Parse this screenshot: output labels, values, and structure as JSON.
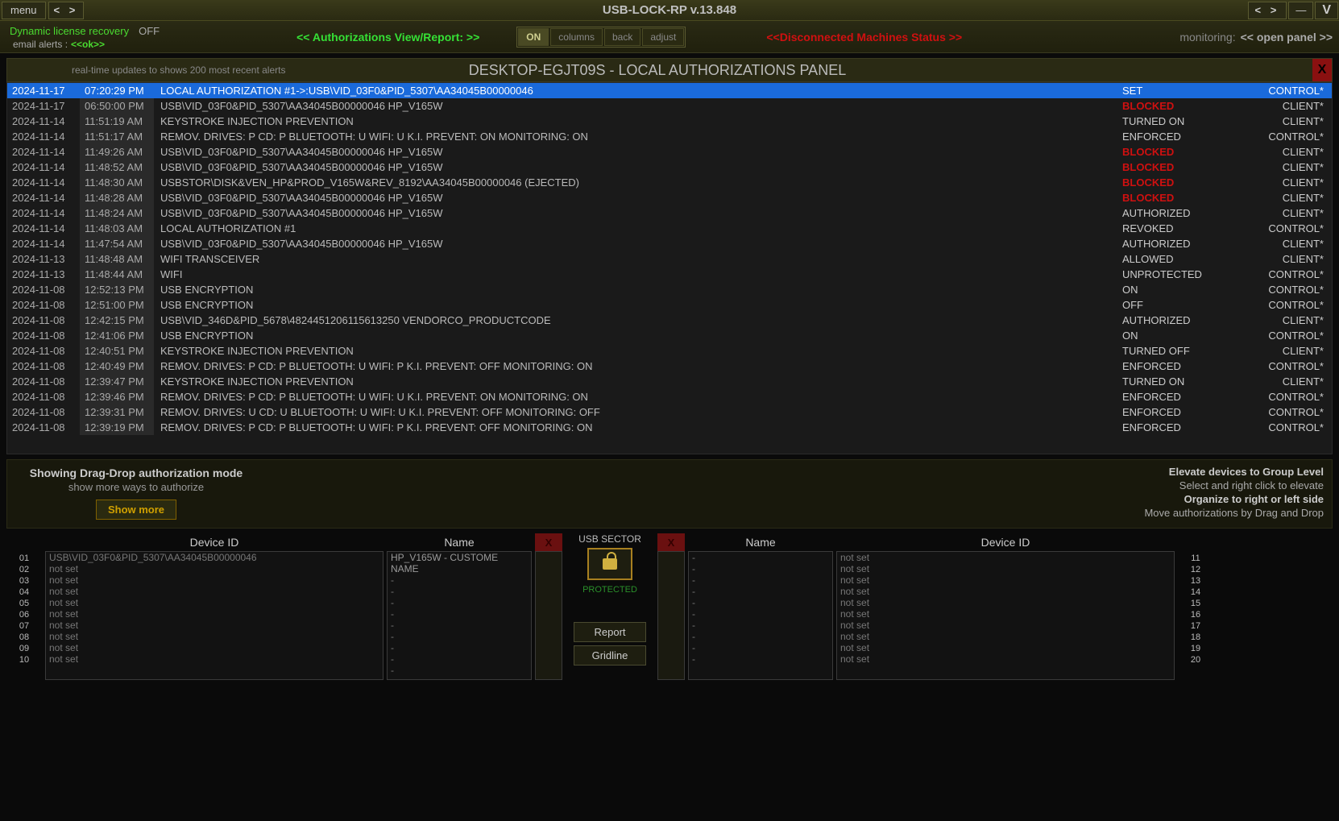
{
  "titlebar": {
    "menu": "menu",
    "arrows": "<  >",
    "title": "USB-LOCK-RP v.13.848",
    "minimize": "—",
    "version": "V"
  },
  "toolbar": {
    "lic_recovery": "Dynamic license recovery",
    "off": "OFF",
    "email_alerts": "email alerts :",
    "ok": "<<ok>>",
    "auth_view": "<< Authorizations View/Report: >>",
    "btn_on": "ON",
    "btn_columns": "columns",
    "btn_back": "back",
    "btn_adjust": "adjust",
    "disc_status": "<<Disconnected Machines Status >>",
    "monitoring": "monitoring:",
    "open_panel": "<<  open panel >>"
  },
  "panel": {
    "hint": "real-time updates to shows 200 most recent alerts",
    "title": "DESKTOP-EGJT09S - LOCAL AUTHORIZATIONS PANEL",
    "close": "X"
  },
  "events": [
    {
      "date": "2024-11-17",
      "time": "07:20:29 PM",
      "desc": "LOCAL AUTHORIZATION #1->:USB\\VID_03F0&PID_5307\\AA34045B00000046",
      "status": "SET",
      "src": "CONTROL*",
      "sel": true
    },
    {
      "date": "2024-11-17",
      "time": "06:50:00 PM",
      "desc": "USB\\VID_03F0&PID_5307\\AA34045B00000046 HP_V165W",
      "status": "BLOCKED",
      "src": "CLIENT*"
    },
    {
      "date": "2024-11-14",
      "time": "11:51:19 AM",
      "desc": "KEYSTROKE INJECTION PREVENTION",
      "status": "TURNED ON",
      "src": "CLIENT*"
    },
    {
      "date": "2024-11-14",
      "time": "11:51:17 AM",
      "desc": "REMOV. DRIVES: P     CD: P     BLUETOOTH: U     WIFI: U     K.I. PREVENT: ON  MONITORING: ON",
      "status": "ENFORCED",
      "src": "CONTROL*"
    },
    {
      "date": "2024-11-14",
      "time": "11:49:26 AM",
      "desc": "USB\\VID_03F0&PID_5307\\AA34045B00000046 HP_V165W",
      "status": "BLOCKED",
      "src": "CLIENT*"
    },
    {
      "date": "2024-11-14",
      "time": "11:48:52 AM",
      "desc": "USB\\VID_03F0&PID_5307\\AA34045B00000046 HP_V165W",
      "status": "BLOCKED",
      "src": "CLIENT*"
    },
    {
      "date": "2024-11-14",
      "time": "11:48:30 AM",
      "desc": "USBSTOR\\DISK&VEN_HP&PROD_V165W&REV_8192\\AA34045B00000046   (EJECTED)",
      "status": "BLOCKED",
      "src": "CLIENT*"
    },
    {
      "date": "2024-11-14",
      "time": "11:48:28 AM",
      "desc": "USB\\VID_03F0&PID_5307\\AA34045B00000046 HP_V165W",
      "status": "BLOCKED",
      "src": "CLIENT*"
    },
    {
      "date": "2024-11-14",
      "time": "11:48:24 AM",
      "desc": "USB\\VID_03F0&PID_5307\\AA34045B00000046 HP_V165W",
      "status": "AUTHORIZED",
      "src": "CLIENT*"
    },
    {
      "date": "2024-11-14",
      "time": "11:48:03 AM",
      "desc": "LOCAL AUTHORIZATION #1",
      "status": "REVOKED",
      "src": "CONTROL*"
    },
    {
      "date": "2024-11-14",
      "time": "11:47:54 AM",
      "desc": "USB\\VID_03F0&PID_5307\\AA34045B00000046 HP_V165W",
      "status": "AUTHORIZED",
      "src": "CLIENT*"
    },
    {
      "date": "2024-11-13",
      "time": "11:48:48 AM",
      "desc": "WIFI TRANSCEIVER",
      "status": "ALLOWED",
      "src": "CLIENT*"
    },
    {
      "date": "2024-11-13",
      "time": "11:48:44 AM",
      "desc": "WIFI",
      "status": "UNPROTECTED",
      "src": "CONTROL*"
    },
    {
      "date": "2024-11-08",
      "time": "12:52:13 PM",
      "desc": "USB ENCRYPTION",
      "status": "ON",
      "src": "CONTROL*"
    },
    {
      "date": "2024-11-08",
      "time": "12:51:00 PM",
      "desc": "USB ENCRYPTION",
      "status": "OFF",
      "src": "CONTROL*"
    },
    {
      "date": "2024-11-08",
      "time": "12:42:15 PM",
      "desc": "USB\\VID_346D&PID_5678\\4824451206115613250 VENDORCO_PRODUCTCODE",
      "status": "AUTHORIZED",
      "src": "CLIENT*"
    },
    {
      "date": "2024-11-08",
      "time": "12:41:06 PM",
      "desc": "USB ENCRYPTION",
      "status": "ON",
      "src": "CONTROL*"
    },
    {
      "date": "2024-11-08",
      "time": "12:40:51 PM",
      "desc": "KEYSTROKE INJECTION PREVENTION",
      "status": "TURNED OFF",
      "src": "CLIENT*"
    },
    {
      "date": "2024-11-08",
      "time": "12:40:49 PM",
      "desc": "REMOV. DRIVES: P     CD: P     BLUETOOTH: U     WIFI: P     K.I. PREVENT: OFF  MONITORING: ON",
      "status": "ENFORCED",
      "src": "CONTROL*"
    },
    {
      "date": "2024-11-08",
      "time": "12:39:47 PM",
      "desc": "KEYSTROKE INJECTION PREVENTION",
      "status": "TURNED ON",
      "src": "CLIENT*"
    },
    {
      "date": "2024-11-08",
      "time": "12:39:46 PM",
      "desc": "REMOV. DRIVES: P     CD: P     BLUETOOTH: U     WIFI: U     K.I. PREVENT: ON  MONITORING: ON",
      "status": "ENFORCED",
      "src": "CONTROL*"
    },
    {
      "date": "2024-11-08",
      "time": "12:39:31 PM",
      "desc": "REMOV. DRIVES: U     CD: U     BLUETOOTH: U     WIFI: U     K.I. PREVENT: OFF  MONITORING: OFF",
      "status": "ENFORCED",
      "src": "CONTROL*"
    },
    {
      "date": "2024-11-08",
      "time": "12:39:19 PM",
      "desc": "REMOV. DRIVES: P     CD: P     BLUETOOTH: U     WIFI: P     K.I. PREVENT: OFF  MONITORING: ON",
      "status": "ENFORCED",
      "src": "CONTROL*"
    }
  ],
  "info": {
    "drag_t1": "Showing Drag-Drop authorization mode",
    "drag_t2": "show more ways to authorize",
    "show_more": "Show more",
    "elev_t1": "Elevate devices to Group Level",
    "elev_t2": "Select and right click to elevate",
    "elev_t3": "Organize to right or left side",
    "elev_t4": "Move authorizations by Drag and Drop"
  },
  "bottom": {
    "hdr_device": "Device ID",
    "hdr_name": "Name",
    "red_x": "X",
    "left_nums": [
      "01",
      "02",
      "03",
      "04",
      "05",
      "06",
      "07",
      "08",
      "09",
      "10"
    ],
    "right_nums": [
      "11",
      "12",
      "13",
      "14",
      "15",
      "16",
      "17",
      "18",
      "19",
      "20"
    ],
    "left_devices": [
      "USB\\VID_03F0&PID_5307\\AA34045B00000046",
      "not set",
      "not set",
      "not set",
      "not set",
      "not set",
      "not set",
      "not set",
      "not set",
      "not set"
    ],
    "left_names": [
      "HP_V165W - CUSTOME NAME",
      "-",
      "-",
      "-",
      "-",
      "-",
      "-",
      "-",
      "-",
      "-"
    ],
    "right_names": [
      "-",
      "-",
      "-",
      "-",
      "-",
      "-",
      "-",
      "-",
      "-",
      "-"
    ],
    "right_devices": [
      "not set",
      "not set",
      "not set",
      "not set",
      "not set",
      "not set",
      "not set",
      "not set",
      "not set",
      "not set"
    ],
    "sector_label": "USB SECTOR",
    "protected": "PROTECTED",
    "report": "Report",
    "gridline": "Gridline"
  }
}
